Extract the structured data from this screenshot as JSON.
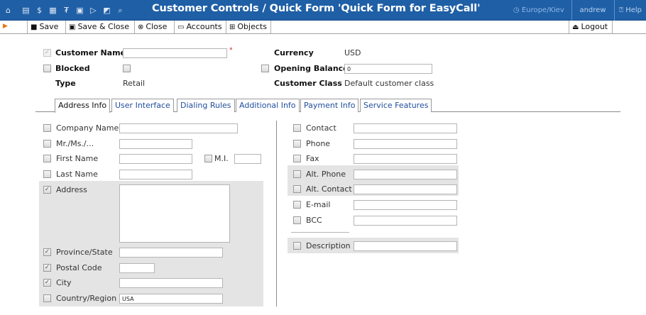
{
  "header": {
    "title": "Customer Controls / Quick Form 'Quick Form for EasyCall'",
    "timezone": "Europe/Kiev",
    "user": "andrew",
    "help": "Help"
  },
  "toolbar": {
    "save": "Save",
    "save_close": "Save & Close",
    "close": "Close",
    "accounts": "Accounts",
    "objects": "Objects",
    "logout": "Logout"
  },
  "customer": {
    "customer_name_label": "Customer Name",
    "customer_name_value": "",
    "blocked_label": "Blocked",
    "type_label": "Type",
    "type_value": "Retail",
    "currency_label": "Currency",
    "currency_value": "USD",
    "opening_balance_label": "Opening Balance",
    "opening_balance_value": "0",
    "customer_class_label": "Customer Class",
    "customer_class_value": "Default customer class"
  },
  "tabs": [
    "Address Info",
    "User Interface",
    "Dialing Rules",
    "Additional Info",
    "Payment Info",
    "Service Features"
  ],
  "address_left": {
    "company_name": {
      "label": "Company Name",
      "value": ""
    },
    "salutation": {
      "label": "Mr./Ms./...",
      "value": ""
    },
    "first_name": {
      "label": "First Name",
      "value": ""
    },
    "mi": {
      "label": "M.I.",
      "value": ""
    },
    "last_name": {
      "label": "Last Name",
      "value": ""
    },
    "address": {
      "label": "Address",
      "value": ""
    },
    "province": {
      "label": "Province/State",
      "value": ""
    },
    "postal_code": {
      "label": "Postal Code",
      "value": ""
    },
    "city": {
      "label": "City",
      "value": ""
    },
    "country": {
      "label": "Country/Region",
      "value": "USA"
    }
  },
  "address_right": {
    "contact": {
      "label": "Contact",
      "value": ""
    },
    "phone": {
      "label": "Phone",
      "value": ""
    },
    "fax": {
      "label": "Fax",
      "value": ""
    },
    "alt_phone": {
      "label": "Alt. Phone",
      "value": ""
    },
    "alt_contact": {
      "label": "Alt. Contact",
      "value": ""
    },
    "email": {
      "label": "E-mail",
      "value": ""
    },
    "bcc": {
      "label": "BCC",
      "value": ""
    },
    "description": {
      "label": "Description",
      "value": ""
    }
  }
}
